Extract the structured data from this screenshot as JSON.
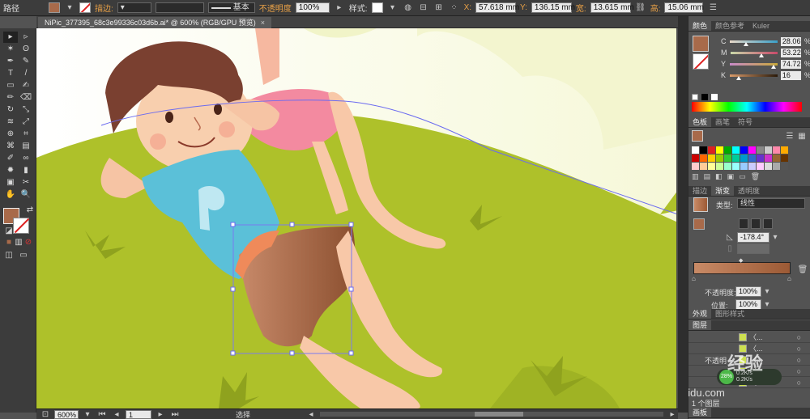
{
  "control": {
    "object_type": "路径",
    "fill_color": "#a86a4a",
    "stroke_label": "描边:",
    "stroke_profile": "基本",
    "opacity_label": "不透明度",
    "opacity_value": "100%",
    "style_label": "样式:",
    "x_label": "X:",
    "x_value": "57.618 mm",
    "y_label": "Y:",
    "y_value": "136.15 mm",
    "w_label": "宽:",
    "w_value": "13.615 mm",
    "h_label": "高:",
    "h_value": "15.06 mm"
  },
  "document_tab": {
    "title": "NiPic_377395_68c3e99336c03d6b.ai* @ 600% (RGB/GPU 预览)",
    "close": "×"
  },
  "toolbar": {
    "fill_color": "#a86a4a",
    "icons": [
      "selection-tool-icon",
      "direct-selection-tool-icon",
      "magic-wand-tool-icon",
      "lasso-tool-icon",
      "pen-tool-icon",
      "curvature-tool-icon",
      "type-tool-icon",
      "line-segment-tool-icon",
      "rectangle-tool-icon",
      "paintbrush-tool-icon",
      "pencil-tool-icon",
      "eraser-tool-icon",
      "rotate-tool-icon",
      "scale-tool-icon",
      "width-tool-icon",
      "free-transform-tool-icon",
      "shape-builder-tool-icon",
      "perspective-grid-tool-icon",
      "mesh-tool-icon",
      "gradient-tool-icon",
      "eyedropper-tool-icon",
      "blend-tool-icon",
      "symbol-sprayer-tool-icon",
      "column-graph-tool-icon",
      "artboard-tool-icon",
      "slice-tool-icon",
      "hand-tool-icon",
      "zoom-tool-icon"
    ],
    "glyphs": [
      "▸",
      "▹",
      "✶",
      "ʘ",
      "✒",
      "✎",
      "T",
      "/",
      "▭",
      "✍",
      "✏",
      "⌫",
      "↻",
      "⤡",
      "≋",
      "⤢",
      "⊕",
      "⌗",
      "⌘",
      "▤",
      "✐",
      "∞",
      "✹",
      "▮",
      "▣",
      "✂",
      "✋",
      "🔍"
    ]
  },
  "color_panel": {
    "tabs": [
      "颜色",
      "颜色参考",
      "Kuler"
    ],
    "swatch": "#a86a4a",
    "channels": [
      {
        "key": "C",
        "value": "28.06",
        "pct": "%",
        "fraction": 0.28,
        "gradient": "linear-gradient(to right,#e8d8c8,#3aa0c8)"
      },
      {
        "key": "M",
        "value": "53.22",
        "pct": "%",
        "fraction": 0.53,
        "gradient": "linear-gradient(to right,#c8d8a8,#c84a6a)"
      },
      {
        "key": "Y",
        "value": "74.72",
        "pct": "%",
        "fraction": 0.75,
        "gradient": "linear-gradient(to right,#c88ac8,#c8a83a)"
      },
      {
        "key": "K",
        "value": "16",
        "pct": "%",
        "fraction": 0.16,
        "gradient": "linear-gradient(to right,#d89a6a,#2a1a0a)"
      }
    ]
  },
  "swatches_panel": {
    "tabs": [
      "色板",
      "画笔",
      "符号"
    ]
  },
  "gradient_panel": {
    "tabs": [
      "描边",
      "渐变",
      "透明度"
    ],
    "type_label": "类型:",
    "type_value": "线性",
    "angle_value": "-178.4°",
    "opacity_label": "不透明度:",
    "opacity_value": "100%",
    "position_label": "位置:",
    "position_value": "100%"
  },
  "appearance_panel": {
    "tabs": [
      "外观",
      "图形样式"
    ]
  },
  "layers_panel": {
    "title": "图层",
    "rows": [
      "〈...",
      "〈...",
      "〈...",
      "〈...",
      "〈..."
    ],
    "opacity_label": "不透明",
    "count_label": "1 个图层",
    "artboard_tab": "画板"
  },
  "network_widget": {
    "percent": "28%",
    "up": "0.2K/s",
    "down": "0.2K/s"
  },
  "watermark": {
    "text": "经验",
    "url": "jingyan.baidu.com"
  },
  "status": {
    "zoom": "600%",
    "artboard": "1",
    "tool": "选择"
  }
}
